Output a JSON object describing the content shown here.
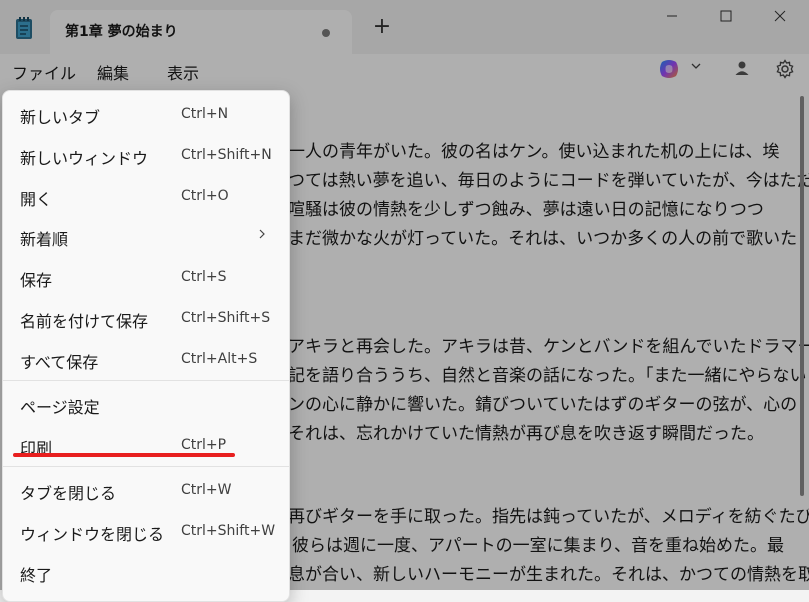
{
  "tab": {
    "title": "第1章 夢の始まり"
  },
  "menubar": {
    "file": "ファイル",
    "edit": "編集",
    "view": "表示"
  },
  "editor": {
    "lines": [
      "一人の青年がいた。彼の名はケン。使い込まれた机の上には、埃",
      "つては熱い夢を追い、毎日のようにコードを弾いていたが、今はただ",
      "喧騒は彼の情熱を少しずつ蝕み、夢は遠い日の記憶になりつつ",
      "まだ微かな火が灯っていた。それは、いつか多くの人の前で歌いた",
      "アキラと再会した。アキラは昔、ケンとバンドを組んでいたドラマー",
      "記を語り合ううち、自然と音楽の話になった。「また一緒にやらない",
      "ンの心に静かに響いた。錆びついていたはずのギターの弦が、心の",
      "それは、忘れかけていた情熱が再び息を吹き返す瞬間だった。",
      "再びギターを手に取った。指先は鈍っていたが、メロディを紡ぐたび",
      "彼らは週に一度、アパートの一室に集まり、音を重ね始めた。最",
      "息が合い、新しいハーモニーが生まれた。それは、かつての情熱を取"
    ]
  },
  "file_menu": {
    "items": [
      {
        "label": "新しいタブ",
        "shortcut": "Ctrl+N"
      },
      {
        "label": "新しいウィンドウ",
        "shortcut": "Ctrl+Shift+N"
      },
      {
        "label": "開く",
        "shortcut": "Ctrl+O"
      },
      {
        "label": "新着順",
        "shortcut": ""
      },
      {
        "label": "保存",
        "shortcut": "Ctrl+S"
      },
      {
        "label": "名前を付けて保存",
        "shortcut": "Ctrl+Shift+S"
      },
      {
        "label": "すべて保存",
        "shortcut": "Ctrl+Alt+S"
      },
      {
        "label": "ページ設定",
        "shortcut": ""
      },
      {
        "label": "印刷",
        "shortcut": "Ctrl+P"
      },
      {
        "label": "タブを閉じる",
        "shortcut": "Ctrl+W"
      },
      {
        "label": "ウィンドウを閉じる",
        "shortcut": "Ctrl+Shift+W"
      },
      {
        "label": "終了",
        "shortcut": ""
      }
    ]
  },
  "icons": {
    "app": "notepad-icon",
    "new_tab": "plus-icon",
    "copilot": "copilot-icon",
    "profile": "person-icon",
    "settings": "gear-icon",
    "submenu": "chevron-right-icon"
  },
  "colors": {
    "highlight_underline": "#e81f1f"
  }
}
